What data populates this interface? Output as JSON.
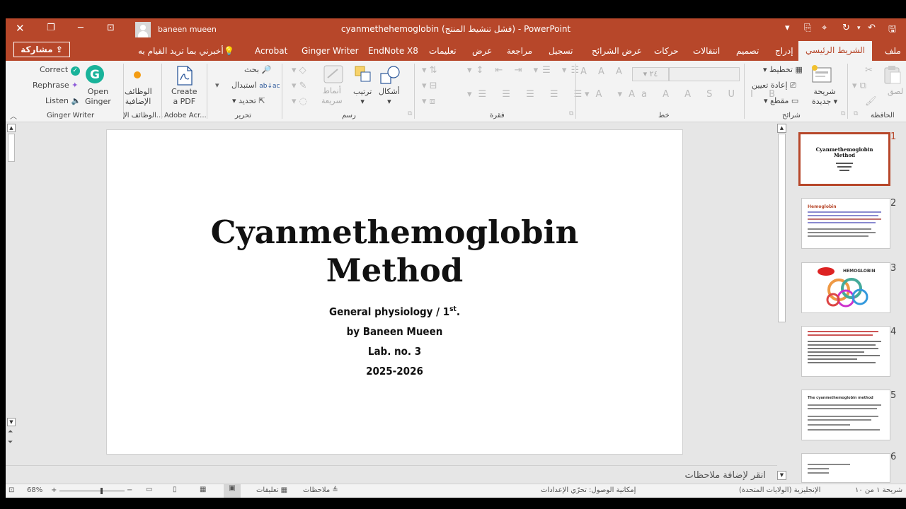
{
  "app": {
    "title": "cyanmethehemoglobin  (فشل تنشيط المنتج)  -  PowerPoint",
    "user": "baneen mueen",
    "accent": "#b7472a"
  },
  "tabs": [
    "ملف",
    "الشريط الرئيسي",
    "إدراج",
    "تصميم",
    "انتقالات",
    "حركات",
    "عرض الشرائح",
    "تسجيل",
    "مراجعة",
    "عرض",
    "تعليمات",
    "EndNote X8",
    "Ginger Writer",
    "Acrobat"
  ],
  "tell_me": "أخبرني بما تريد القيام به",
  "share": "مشاركة",
  "ribbon": {
    "ginger": {
      "correct": "Correct",
      "rephrase": "Rephrase",
      "listen": "Listen",
      "open": "Open",
      "open2": "Ginger",
      "group": "Ginger Writer"
    },
    "addins": {
      "label1": "الوظائف",
      "label2": "الإضافية",
      "group": "الوظائف الإ..."
    },
    "acrobat": {
      "label1": "Create",
      "label2": "a PDF",
      "group": "Adobe Acr..."
    },
    "editing": {
      "find": "بحث",
      "replace": "استبدال",
      "select": "تحديد",
      "group": "تحرير"
    },
    "drawing": {
      "styles1": "أنماط",
      "styles2": "سريعة",
      "arrange": "ترتيب",
      "shapes": "أشكال",
      "group": "رسم"
    },
    "paragraph": {
      "group": "فقرة"
    },
    "font": {
      "size": "٢٤",
      "group": "خط"
    },
    "slides": {
      "layout": "تخطيط",
      "reset": "إعادة تعيين",
      "section": "مقطع",
      "new1": "شريحة",
      "new2": "جديدة",
      "group": "شرائح"
    },
    "clipboard": {
      "paste": "لصق",
      "group": "الحافظة"
    }
  },
  "slide": {
    "title_line1": "Cyanmethemoglobin",
    "title_line2": "Method",
    "sub1": "General physiology / 1",
    "sub1_sup": "st",
    "sub1_end": ".",
    "sub2": "by Baneen Mueen",
    "sub3": "Lab. no. 3",
    "sub4": "2025-2026"
  },
  "thumbnails": [
    {
      "num": "1",
      "title": "Cyanmethemoglobin Method",
      "selected": true
    },
    {
      "num": "2",
      "title": "Hemoglobin"
    },
    {
      "num": "3",
      "title": "HEMOGLOBIN"
    },
    {
      "num": "4",
      "title": ""
    },
    {
      "num": "5",
      "title": "The cyanmethemoglobin method"
    },
    {
      "num": "6",
      "title": ""
    }
  ],
  "notes_placeholder": "انقر لإضافة ملاحظات",
  "status": {
    "zoom": "68%",
    "comments": "تعليقات",
    "notes": "ملاحظات",
    "language": "الإنجليزية (الولايات المتحدة)",
    "accessibility": "إمكانية الوصول: تحرّي الإعدادات",
    "slide_of": "شريحة ١ من ١٠"
  }
}
